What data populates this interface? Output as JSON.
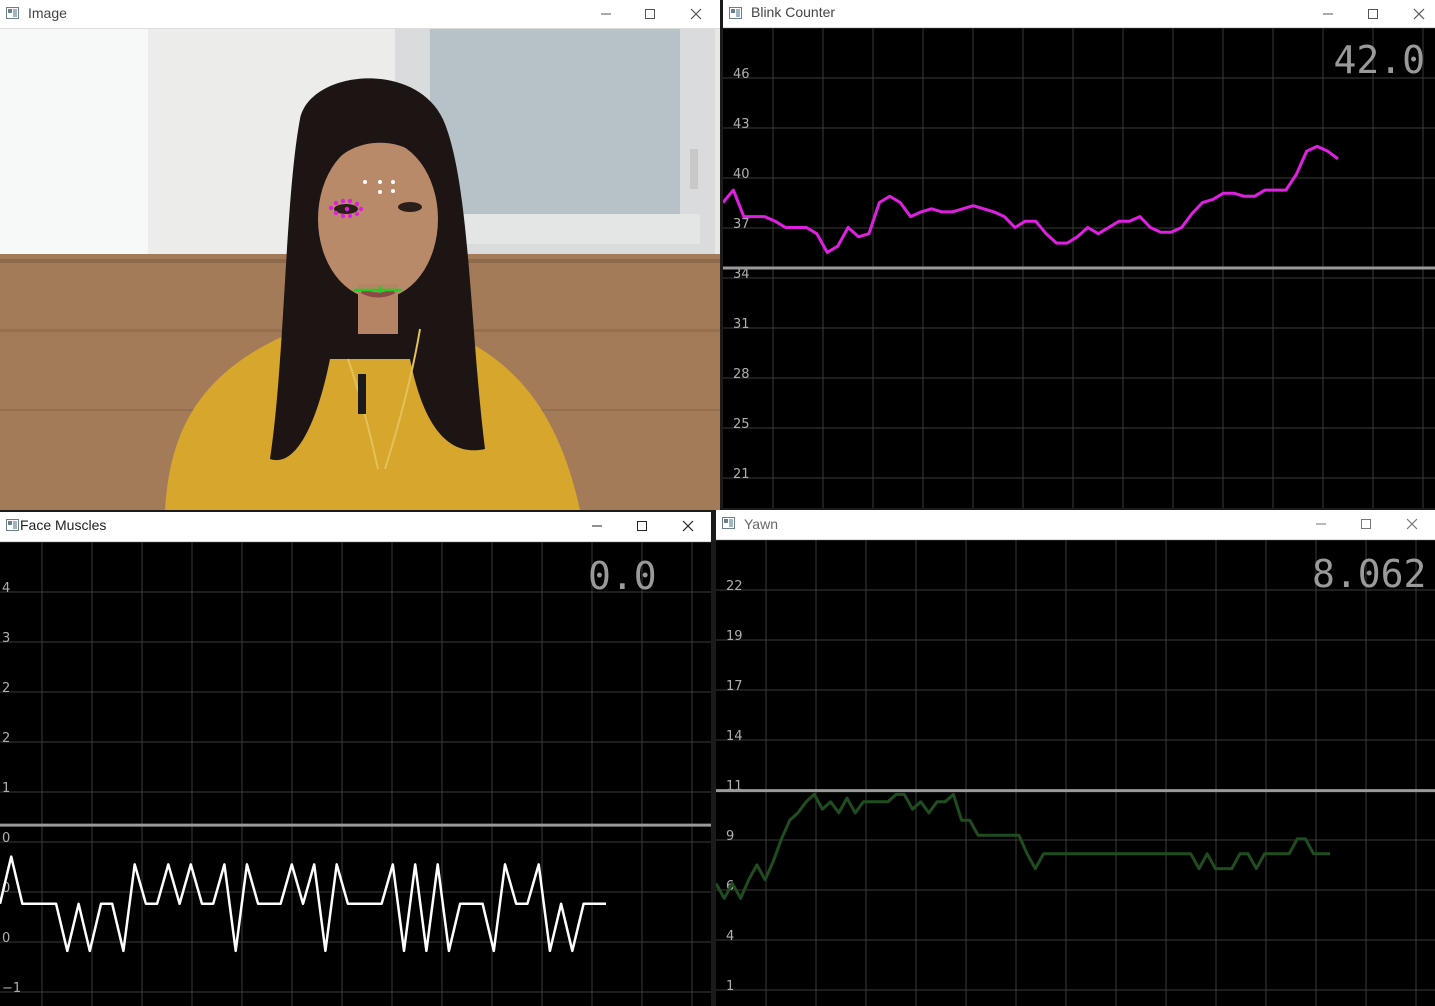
{
  "windows": {
    "image": {
      "title": "Image"
    },
    "blink": {
      "title": "Blink Counter"
    },
    "face": {
      "title": "Face Muscles"
    },
    "yawn": {
      "title": "Yawn"
    }
  },
  "icons": {
    "app": "window-app-icon",
    "minimize": "minimize-icon",
    "maximize": "maximize-icon",
    "close": "close-icon"
  },
  "colors": {
    "blink_line": "#e020e0",
    "face_line": "#ffffff",
    "yawn_line": "#1f4d1f",
    "landmark_eye": "#e020e0",
    "landmark_mouth": "#22cc22"
  },
  "chart_data": [
    {
      "id": "blink",
      "type": "line",
      "current_value": "42.0",
      "y_ticks": [
        "46",
        "43",
        "40",
        "37",
        "34",
        "31",
        "28",
        "25",
        "21"
      ],
      "threshold": 34.0,
      "ylim": [
        18.6,
        49.4
      ],
      "y": [
        38.2,
        39.0,
        37.3,
        37.3,
        37.3,
        37.0,
        36.6,
        36.6,
        36.6,
        36.2,
        35.0,
        35.4,
        36.6,
        36.0,
        36.2,
        38.2,
        38.6,
        38.2,
        37.3,
        37.6,
        37.8,
        37.6,
        37.6,
        37.8,
        38.0,
        37.8,
        37.6,
        37.3,
        36.6,
        37.0,
        37.0,
        36.2,
        35.6,
        35.6,
        36.0,
        36.6,
        36.2,
        36.6,
        37.0,
        37.0,
        37.3,
        36.6,
        36.3,
        36.3,
        36.6,
        37.5,
        38.2,
        38.4,
        38.8,
        38.8,
        38.6,
        38.6,
        39.0,
        39.0,
        39.0,
        40.0,
        41.5,
        41.8,
        41.5,
        41.0
      ],
      "grid": true
    },
    {
      "id": "face",
      "type": "line",
      "current_value": "0.0",
      "y_ticks": [
        "4",
        "3",
        "2",
        "2",
        "1",
        "0",
        "0",
        "0",
        "−1"
      ],
      "threshold": 1.0,
      "ylim": [
        -1.3,
        4.6
      ],
      "y": [
        0.0,
        0.6,
        0.0,
        0.0,
        0.0,
        0.0,
        -0.6,
        0.0,
        -0.6,
        0.0,
        0.0,
        -0.6,
        0.5,
        0.0,
        0.0,
        0.5,
        0.0,
        0.5,
        0.0,
        0.0,
        0.5,
        -0.6,
        0.5,
        0.0,
        0.0,
        0.0,
        0.5,
        0.0,
        0.5,
        -0.6,
        0.5,
        0.0,
        0.0,
        0.0,
        0.0,
        0.5,
        -0.6,
        0.5,
        -0.6,
        0.5,
        -0.6,
        0.0,
        0.0,
        0.0,
        -0.6,
        0.5,
        0.0,
        0.0,
        0.5,
        -0.6,
        0.0,
        -0.6,
        0.0,
        0.0,
        0.0
      ],
      "grid": true
    },
    {
      "id": "yawn",
      "type": "line",
      "current_value": "8.062",
      "y_ticks": [
        "22",
        "19",
        "17",
        "14",
        "11",
        "9",
        "6",
        "4",
        "1"
      ],
      "threshold": 11.0,
      "ylim": [
        -0.6,
        24.5
      ],
      "y": [
        6.0,
        5.2,
        6.0,
        5.2,
        6.2,
        7.0,
        6.2,
        7.2,
        8.4,
        9.4,
        9.8,
        10.4,
        10.8,
        10.0,
        10.4,
        9.8,
        10.6,
        9.8,
        10.4,
        10.4,
        10.4,
        10.4,
        10.8,
        10.8,
        10.0,
        10.4,
        9.8,
        10.4,
        10.4,
        10.8,
        9.4,
        9.4,
        8.6,
        8.6,
        8.6,
        8.6,
        8.6,
        8.6,
        7.6,
        6.8,
        7.6,
        7.6,
        7.6,
        7.6,
        7.6,
        7.6,
        7.6,
        7.6,
        7.6,
        7.6,
        7.6,
        7.6,
        7.6,
        7.6,
        7.6,
        7.6,
        7.6,
        7.6,
        7.6,
        6.8,
        7.6,
        6.8,
        6.8,
        6.8,
        7.6,
        7.6,
        6.8,
        7.6,
        7.6,
        7.6,
        7.6,
        8.4,
        8.4,
        7.6,
        7.6,
        7.6
      ],
      "grid": true
    }
  ]
}
